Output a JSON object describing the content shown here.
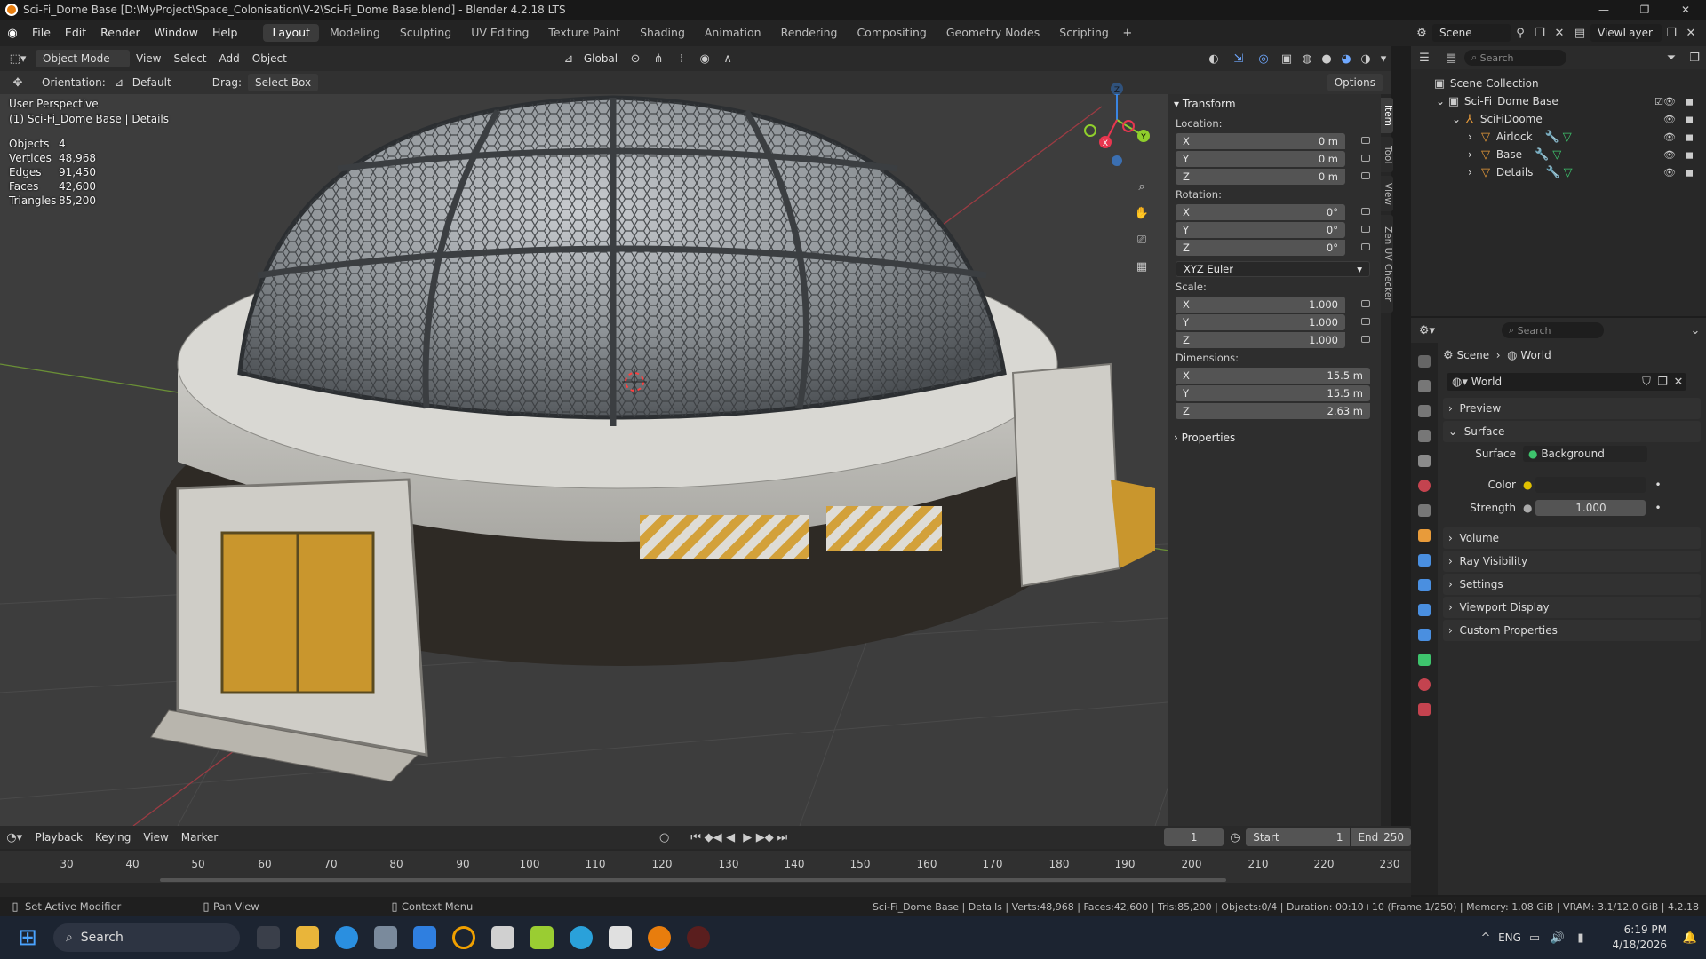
{
  "window": {
    "title": "Sci-Fi_Dome Base [D:\\MyProject\\Space_Colonisation\\V-2\\Sci-Fi_Dome Base.blend] - Blender 4.2.18 LTS",
    "controls": [
      "—",
      "❐",
      "✕"
    ]
  },
  "menu": [
    "File",
    "Edit",
    "Render",
    "Window",
    "Help"
  ],
  "workspaces": [
    "Layout",
    "Modeling",
    "Sculpting",
    "UV Editing",
    "Texture Paint",
    "Shading",
    "Animation",
    "Rendering",
    "Compositing",
    "Geometry Nodes",
    "Scripting"
  ],
  "active_workspace": "Layout",
  "topright": {
    "scene_label": "Scene",
    "viewlayer_label": "ViewLayer"
  },
  "header3d": {
    "mode": "Object Mode",
    "menus": [
      "View",
      "Select",
      "Add",
      "Object"
    ],
    "transform_orientation": "Global",
    "options": "Options"
  },
  "toolsettings": {
    "orientation_label": "Orientation:",
    "orientation_value": "Default",
    "drag_label": "Drag:",
    "drag_value": "Select Box"
  },
  "viewport": {
    "perspective": "User Perspective",
    "object_info": "(1) Sci-Fi_Dome Base | Details",
    "stats": [
      {
        "k": "Objects",
        "v": "4"
      },
      {
        "k": "Vertices",
        "v": "48,968"
      },
      {
        "k": "Edges",
        "v": "91,450"
      },
      {
        "k": "Faces",
        "v": "42,600"
      },
      {
        "k": "Triangles",
        "v": "85,200"
      }
    ],
    "gizmo_axes": {
      "x": "X",
      "y": "Y",
      "z": "Z"
    }
  },
  "npanel": {
    "transform_title": "Transform",
    "location_label": "Location:",
    "location": [
      {
        "a": "X",
        "v": "0 m"
      },
      {
        "a": "Y",
        "v": "0 m"
      },
      {
        "a": "Z",
        "v": "0 m"
      }
    ],
    "rotation_label": "Rotation:",
    "rotation": [
      {
        "a": "X",
        "v": "0°"
      },
      {
        "a": "Y",
        "v": "0°"
      },
      {
        "a": "Z",
        "v": "0°"
      }
    ],
    "rotation_mode": "XYZ Euler",
    "scale_label": "Scale:",
    "scale": [
      {
        "a": "X",
        "v": "1.000"
      },
      {
        "a": "Y",
        "v": "1.000"
      },
      {
        "a": "Z",
        "v": "1.000"
      }
    ],
    "dimensions_label": "Dimensions:",
    "dimensions": [
      {
        "a": "X",
        "v": "15.5 m"
      },
      {
        "a": "Y",
        "v": "15.5 m"
      },
      {
        "a": "Z",
        "v": "2.63 m"
      }
    ],
    "properties_title": "Properties",
    "tabs": [
      "Item",
      "Tool",
      "View",
      "Zen UV Checker"
    ]
  },
  "outliner": {
    "search_placeholder": "Search",
    "items": [
      {
        "label": "Scene Collection",
        "level": 0
      },
      {
        "label": "Sci-Fi_Dome Base",
        "level": 1
      },
      {
        "label": "SciFiDoome",
        "level": 2
      },
      {
        "label": "Airlock",
        "level": 3
      },
      {
        "label": "Base",
        "level": 3
      },
      {
        "label": "Details",
        "level": 3
      }
    ]
  },
  "properties": {
    "search_placeholder": "Search",
    "breadcrumb_scene": "Scene",
    "breadcrumb_world": "World",
    "world_name": "World",
    "sections": [
      "Preview",
      "Surface",
      "Volume",
      "Ray Visibility",
      "Settings",
      "Viewport Display",
      "Custom Properties"
    ],
    "surface_label": "Surface",
    "surface_value": "Background",
    "color_label": "Color",
    "strength_label": "Strength",
    "strength_value": "1.000"
  },
  "timeline": {
    "menus": [
      "Playback",
      "Keying",
      "View",
      "Marker"
    ],
    "current_frame": "1",
    "start_label": "Start",
    "start": "1",
    "end_label": "End",
    "end": "250",
    "ticks": [
      "30",
      "40",
      "50",
      "60",
      "70",
      "80",
      "90",
      "100",
      "110",
      "120",
      "130",
      "140",
      "150",
      "160",
      "170",
      "180",
      "190",
      "200",
      "210",
      "220",
      "230"
    ]
  },
  "statusbar": {
    "left1": "Set Active Modifier",
    "left2": "Pan View",
    "left3": "Context Menu",
    "right": "Sci-Fi_Dome Base | Details | Verts:48,968 | Faces:42,600 | Tris:85,200 | Objects:0/4 | Duration: 00:10+10 (Frame 1/250) | Memory: 1.08 GiB | VRAM: 3.1/12.0 GiB | 4.2.18"
  },
  "taskbar": {
    "search": "Search",
    "lang": "ENG",
    "time": "6:19 PM",
    "date": "4/18/2026"
  },
  "colors": {
    "accent": "#e87d0d",
    "axis_x": "#e8364f",
    "axis_y": "#8fcf2c",
    "axis_z": "#3a85e2",
    "field": "#545454"
  }
}
